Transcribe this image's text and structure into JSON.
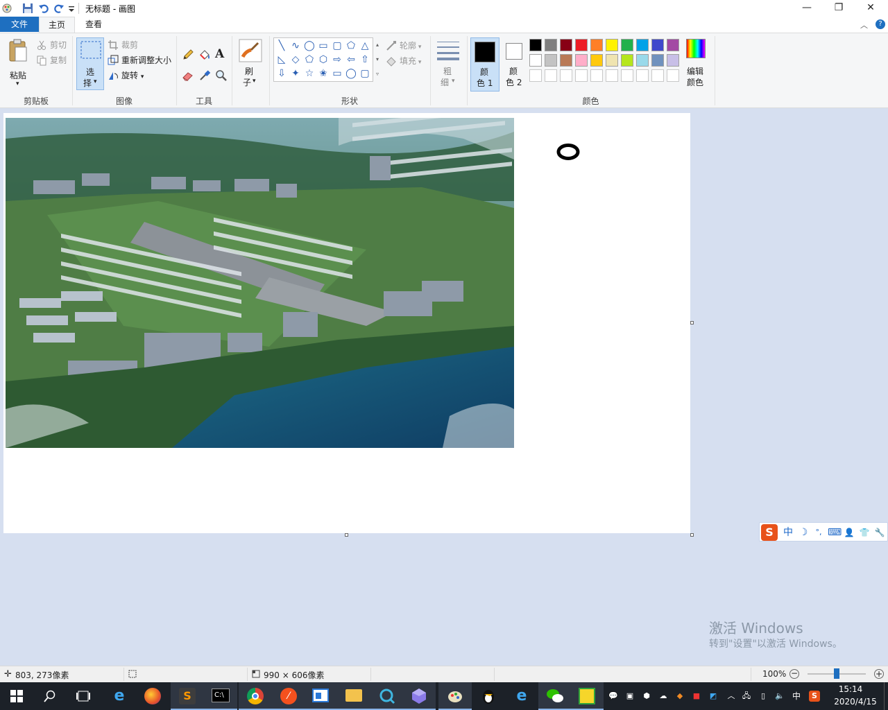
{
  "window": {
    "title": "无标题 - 画图",
    "minimize": "—",
    "restore": "❐",
    "close": "✕"
  },
  "tabs": [
    {
      "label": "文件"
    },
    {
      "label": "主页"
    },
    {
      "label": "查看"
    }
  ],
  "clipboard": {
    "paste": "粘贴",
    "cut": "剪切",
    "copy": "复制",
    "group": "剪贴板"
  },
  "image": {
    "select_1": "选",
    "select_2": "择",
    "crop": "裁剪",
    "resize": "重新调整大小",
    "rotate": "旋转",
    "group": "图像"
  },
  "tools": {
    "group": "工具"
  },
  "brushes": {
    "label_1": "刷",
    "label_2": "子"
  },
  "shapes": {
    "outline": "轮廓",
    "fill": "填充",
    "group": "形状",
    "glyphs": [
      "╲",
      "∿",
      "◯",
      "▭",
      "▢",
      "⬠",
      "△",
      "◺",
      "◇",
      "⬠",
      "⬡",
      "⇨",
      "⇦",
      "⇧",
      "⇩",
      "✦",
      "☆",
      "✬",
      "▭",
      "◯",
      "▢"
    ]
  },
  "size": {
    "label_1": "粗",
    "label_2": "细"
  },
  "colors": {
    "color1_1": "颜",
    "color1_2": "色 1",
    "color2_1": "颜",
    "color2_2": "色 2",
    "edit_1": "编辑",
    "edit_2": "颜色",
    "group": "颜色",
    "color1": "#000000",
    "color2": "#ffffff",
    "palette_row1": [
      "#000000",
      "#7f7f7f",
      "#880015",
      "#ed1c24",
      "#ff7f27",
      "#fff200",
      "#22b14c",
      "#00a2e8",
      "#3f48cc",
      "#a349a4"
    ],
    "palette_row2": [
      "#ffffff",
      "#c3c3c3",
      "#b97a57",
      "#ffaec9",
      "#ffc90e",
      "#efe4b0",
      "#b5e61d",
      "#99d9ea",
      "#7092be",
      "#c8bfe7"
    ]
  },
  "status": {
    "cursor": "803, 273像素",
    "canvas_size": "990 × 606像素",
    "zoom": "100%",
    "zoom_level": 0.5
  },
  "watermark": {
    "line1": "激活 Windows",
    "line2": "转到\"设置\"以激活 Windows。"
  },
  "ime": {
    "logo": "S",
    "mode": "中",
    "moon": "☽",
    "punct": "°,",
    "keyboard": "⌨",
    "user": "👤",
    "shirt": "👕",
    "tool": "🔧"
  },
  "taskbar": {
    "time": "15:14",
    "date": "2020/4/15",
    "lang": "中",
    "ime_tray": "S"
  }
}
